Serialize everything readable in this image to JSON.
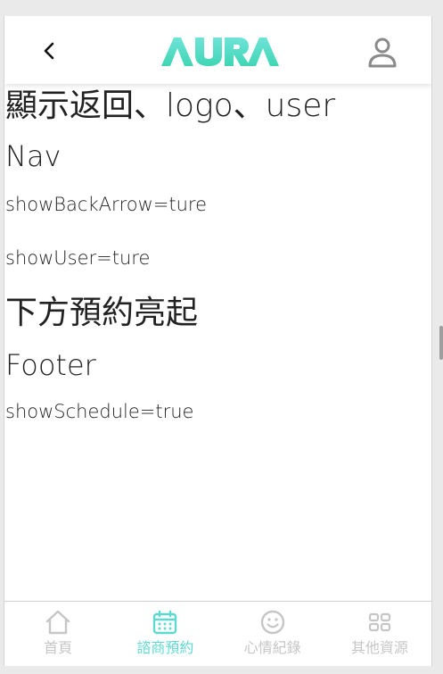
{
  "navbar": {
    "logo_text": "AURA",
    "back_icon": "chevron-left-icon",
    "user_icon": "user-icon"
  },
  "content": {
    "line1": "顯示返回、logo、user",
    "line2": "Nav",
    "line3": "showBackArrow=ture",
    "line4": "showUser=ture",
    "line5": "下方預約亮起",
    "line6": "Footer",
    "line7": "showSchedule=true"
  },
  "footer": {
    "items": [
      {
        "label": "首頁",
        "icon": "home-icon",
        "active": false
      },
      {
        "label": "諮商預約",
        "icon": "calendar-icon",
        "active": true
      },
      {
        "label": "心情紀錄",
        "icon": "smile-icon",
        "active": false
      },
      {
        "label": "其他資源",
        "icon": "grid-icon",
        "active": false
      }
    ]
  },
  "colors": {
    "accent": "#5fd9d0",
    "logo_gradient_start": "#4fe0c8",
    "logo_gradient_end": "#7fe6d6",
    "inactive": "#c6c6c6",
    "text": "#222222"
  }
}
